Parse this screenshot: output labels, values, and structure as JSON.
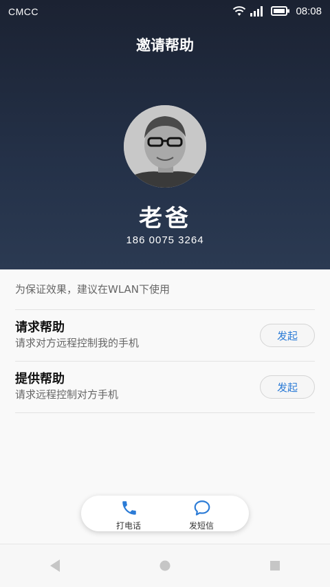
{
  "status_bar": {
    "carrier": "CMCC",
    "time": "08:08",
    "icons": [
      "wifi-icon",
      "signal-icon",
      "battery-icon"
    ]
  },
  "header": {
    "title": "邀请帮助",
    "contact_name": "老爸",
    "contact_phone": "186 0075 3264"
  },
  "content": {
    "tip": "为保证效果，建议在WLAN下使用",
    "options": [
      {
        "title": "请求帮助",
        "subtitle": "请求对方远程控制我的手机",
        "button": "发起"
      },
      {
        "title": "提供帮助",
        "subtitle": "请求远程控制对方手机",
        "button": "发起"
      }
    ]
  },
  "bottom_actions": {
    "call_label": "打电话",
    "sms_label": "发短信"
  },
  "nav_bar": {
    "icons": [
      "back-icon",
      "home-icon",
      "recents-icon"
    ]
  },
  "colors": {
    "header_top": "#1b2232",
    "header_bottom": "#2b3a52",
    "accent": "#2b7bd6"
  }
}
